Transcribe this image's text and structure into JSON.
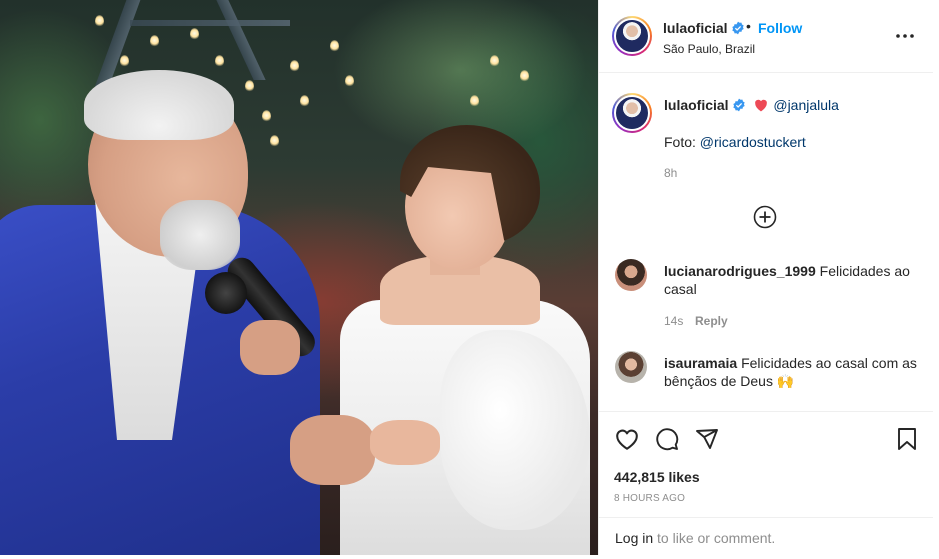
{
  "post": {
    "username": "lulaoficial",
    "follow_label": "Follow",
    "location": "São Paulo, Brazil",
    "more_icon": "more-horizontal-icon"
  },
  "caption": {
    "username": "lulaoficial",
    "mention": "@janjalula",
    "photo_prefix": "Foto: ",
    "photo_mention": "@ricardostuckert",
    "time": "8h"
  },
  "comments": [
    {
      "username": "lucianarodrigues_1999",
      "text": "Felicidades ao casal",
      "time": "14s",
      "reply_label": "Reply"
    },
    {
      "username": "isauramaia",
      "text": "Felicidades ao casal com as bênçãos de Deus 🙌",
      "time": "",
      "reply_label": ""
    }
  ],
  "actions": {
    "like_icon": "heart-icon",
    "comment_icon": "comment-icon",
    "share_icon": "send-icon",
    "save_icon": "bookmark-icon"
  },
  "likes": "442,815 likes",
  "timestamp": "8 HOURS AGO",
  "login": {
    "link_label": "Log in",
    "suffix": " to like or comment."
  },
  "colors": {
    "accent": "#0095f6",
    "verified": "#3897f0",
    "heart": "#ed4956"
  }
}
